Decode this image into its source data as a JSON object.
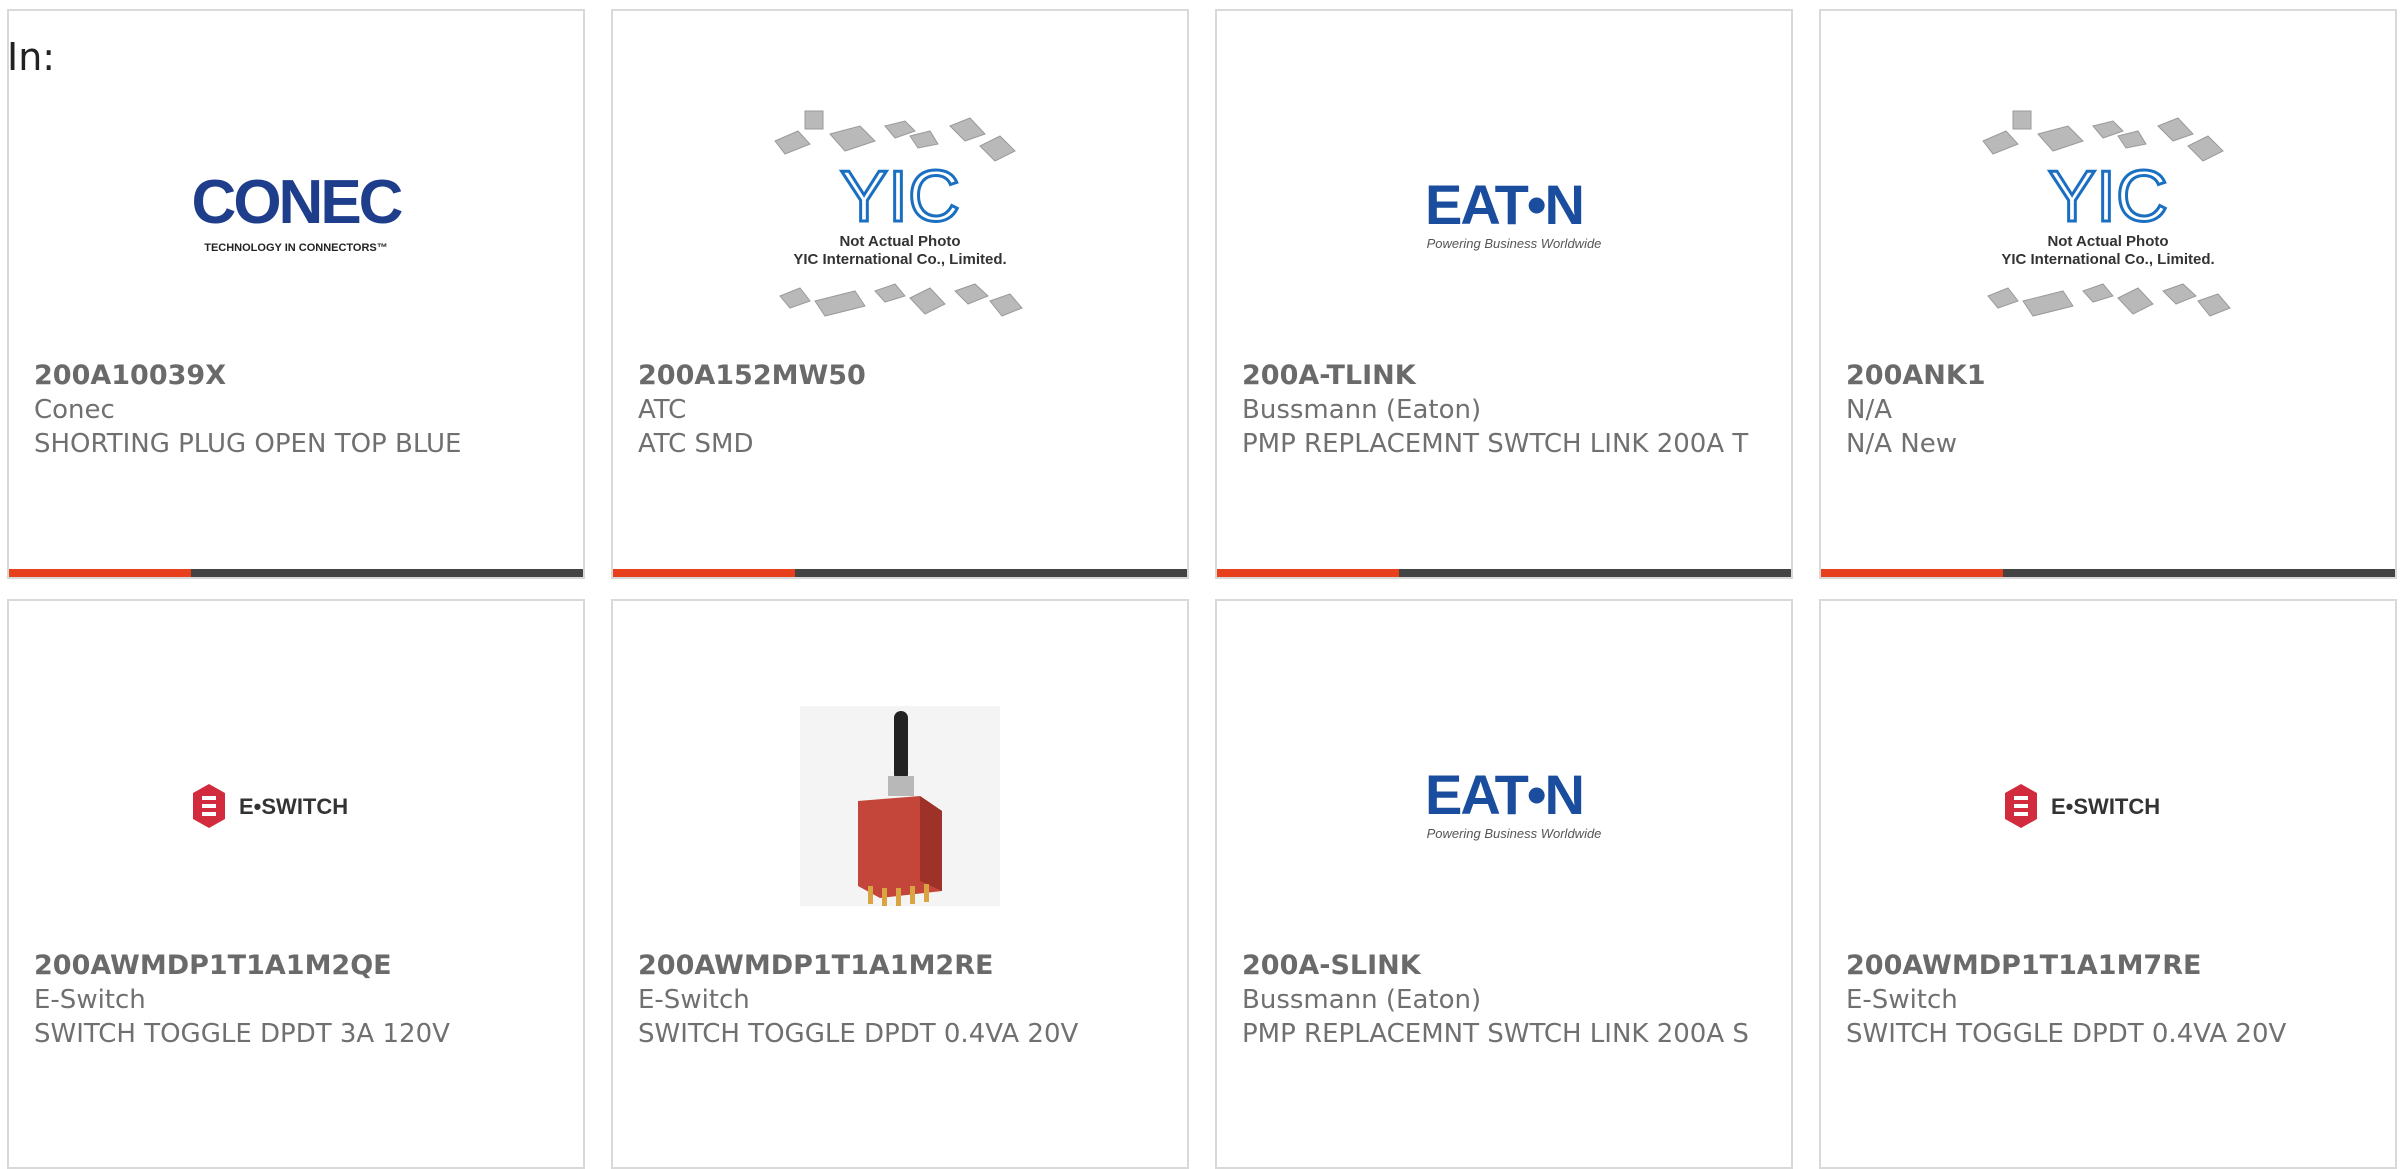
{
  "page": {
    "label": "In:"
  },
  "colors": {
    "accent_bar": "#e8401c",
    "bar": "#444444",
    "text": "#707070"
  },
  "products": [
    {
      "part": "200A10039X",
      "maker": "Conec",
      "desc": "SHORTING PLUG OPEN TOP BLUE",
      "image": "conec-logo",
      "logo": {
        "name": "CONEC",
        "tagline": "Technology in connectors™"
      }
    },
    {
      "part": "200A152MW50",
      "maker": "ATC",
      "desc": "ATC SMD",
      "image": "yic-placeholder",
      "logo": {
        "name": "YIC",
        "tagline": "Not Actual Photo",
        "company": "YIC International Co., Limited."
      }
    },
    {
      "part": "200A-TLINK",
      "maker": "Bussmann (Eaton)",
      "desc": "PMP REPLACEMNT SWTCH LINK 200A T",
      "image": "eaton-logo",
      "logo": {
        "name": "EAT•N",
        "tagline": "Powering Business Worldwide"
      }
    },
    {
      "part": "200ANK1",
      "maker": "N/A",
      "desc": "N/A New",
      "image": "yic-placeholder",
      "logo": {
        "name": "YIC",
        "tagline": "Not Actual Photo",
        "company": "YIC International Co., Limited."
      }
    },
    {
      "part": "200AWMDP1T1A1M2QE",
      "maker": "E-Switch",
      "desc": "SWITCH TOGGLE DPDT 3A 120V",
      "image": "eswitch-logo",
      "logo": {
        "name": "E•SWITCH"
      }
    },
    {
      "part": "200AWMDP1T1A1M2RE",
      "maker": "E-Switch",
      "desc": "SWITCH TOGGLE DPDT 0.4VA 20V",
      "image": "toggle-switch-photo"
    },
    {
      "part": "200A-SLINK",
      "maker": "Bussmann (Eaton)",
      "desc": "PMP REPLACEMNT SWTCH LINK 200A S",
      "image": "eaton-logo",
      "logo": {
        "name": "EAT•N",
        "tagline": "Powering Business Worldwide"
      }
    },
    {
      "part": "200AWMDP1T1A1M7RE",
      "maker": "E-Switch",
      "desc": "SWITCH TOGGLE DPDT 0.4VA 20V",
      "image": "eswitch-logo",
      "logo": {
        "name": "E•SWITCH"
      }
    }
  ]
}
